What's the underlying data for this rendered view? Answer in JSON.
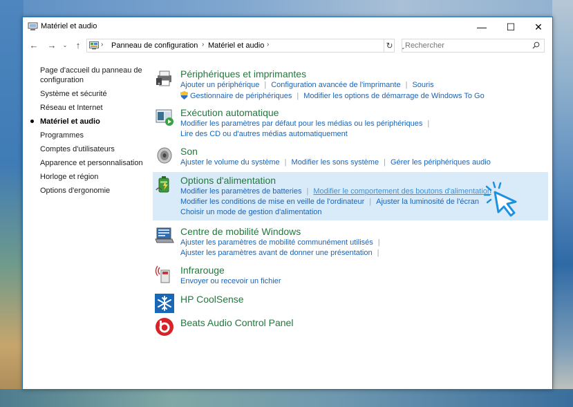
{
  "window": {
    "title": "Matériel et audio",
    "controls": {
      "minimize": "—",
      "maximize": "☐",
      "close": "✕"
    }
  },
  "nav": {
    "back": "←",
    "forward": "→",
    "recent": "⌄",
    "up": "↑",
    "breadcrumb": [
      "Panneau de configuration",
      "Matériel et audio"
    ],
    "separator": "›",
    "dropdown": "⌄",
    "refresh": "↻",
    "search_placeholder": "Rechercher",
    "search_icon": "search-icon"
  },
  "sidebar": {
    "items": [
      {
        "label": "Page d'accueil du panneau de configuration"
      },
      {
        "label": "Système et sécurité"
      },
      {
        "label": "Réseau et Internet"
      },
      {
        "label": "Matériel et audio",
        "current": true
      },
      {
        "label": "Programmes"
      },
      {
        "label": "Comptes d'utilisateurs"
      },
      {
        "label": "Apparence et personnalisation"
      },
      {
        "label": "Horloge et région"
      },
      {
        "label": "Options d'ergonomie"
      }
    ]
  },
  "sections": {
    "devices": {
      "title": "Périphériques et imprimantes",
      "icon": "printer-icon",
      "row1": [
        "Ajouter un périphérique",
        "Configuration avancée de l'imprimante",
        "Souris"
      ],
      "row2": [
        "Gestionnaire de périphériques",
        "Modifier les options de démarrage de Windows To Go"
      ]
    },
    "autoplay": {
      "title": "Exécution automatique",
      "icon": "autoplay-icon",
      "row1": [
        "Modifier les paramètres par défaut pour les médias ou les périphériques"
      ],
      "row2": [
        "Lire des CD ou d'autres médias automatiquement"
      ]
    },
    "sound": {
      "title": "Son",
      "icon": "speaker-icon",
      "row1": [
        "Ajuster le volume du système",
        "Modifier les sons système",
        "Gérer les périphériques audio"
      ]
    },
    "power": {
      "title": "Options d'alimentation",
      "icon": "battery-icon",
      "row1": [
        "Modifier les paramètres de batteries",
        "Modifier le comportement des boutons d'alimentation"
      ],
      "row2": [
        "Modifier les conditions de mise en veille de l'ordinateur",
        "Ajuster la luminosité de l'écran"
      ],
      "row3": [
        "Choisir un mode de gestion d'alimentation"
      ]
    },
    "mobility": {
      "title": "Centre de mobilité Windows",
      "icon": "mobility-icon",
      "row1": [
        "Ajuster les paramètres de mobilité communément utilisés"
      ],
      "row2": [
        "Ajuster les paramètres avant de donner une présentation"
      ]
    },
    "infrared": {
      "title": "Infrarouge",
      "icon": "infrared-icon",
      "row1": [
        "Envoyer ou recevoir un fichier"
      ]
    },
    "coolsense": {
      "title": "HP CoolSense",
      "icon": "snowflake-icon"
    },
    "beats": {
      "title": "Beats Audio Control Panel",
      "icon": "beats-icon"
    }
  },
  "colors": {
    "section_title": "#1e7a3a",
    "link": "#1a63b4",
    "highlight": "#d9ebf9",
    "cursor": "#1e90e0"
  }
}
